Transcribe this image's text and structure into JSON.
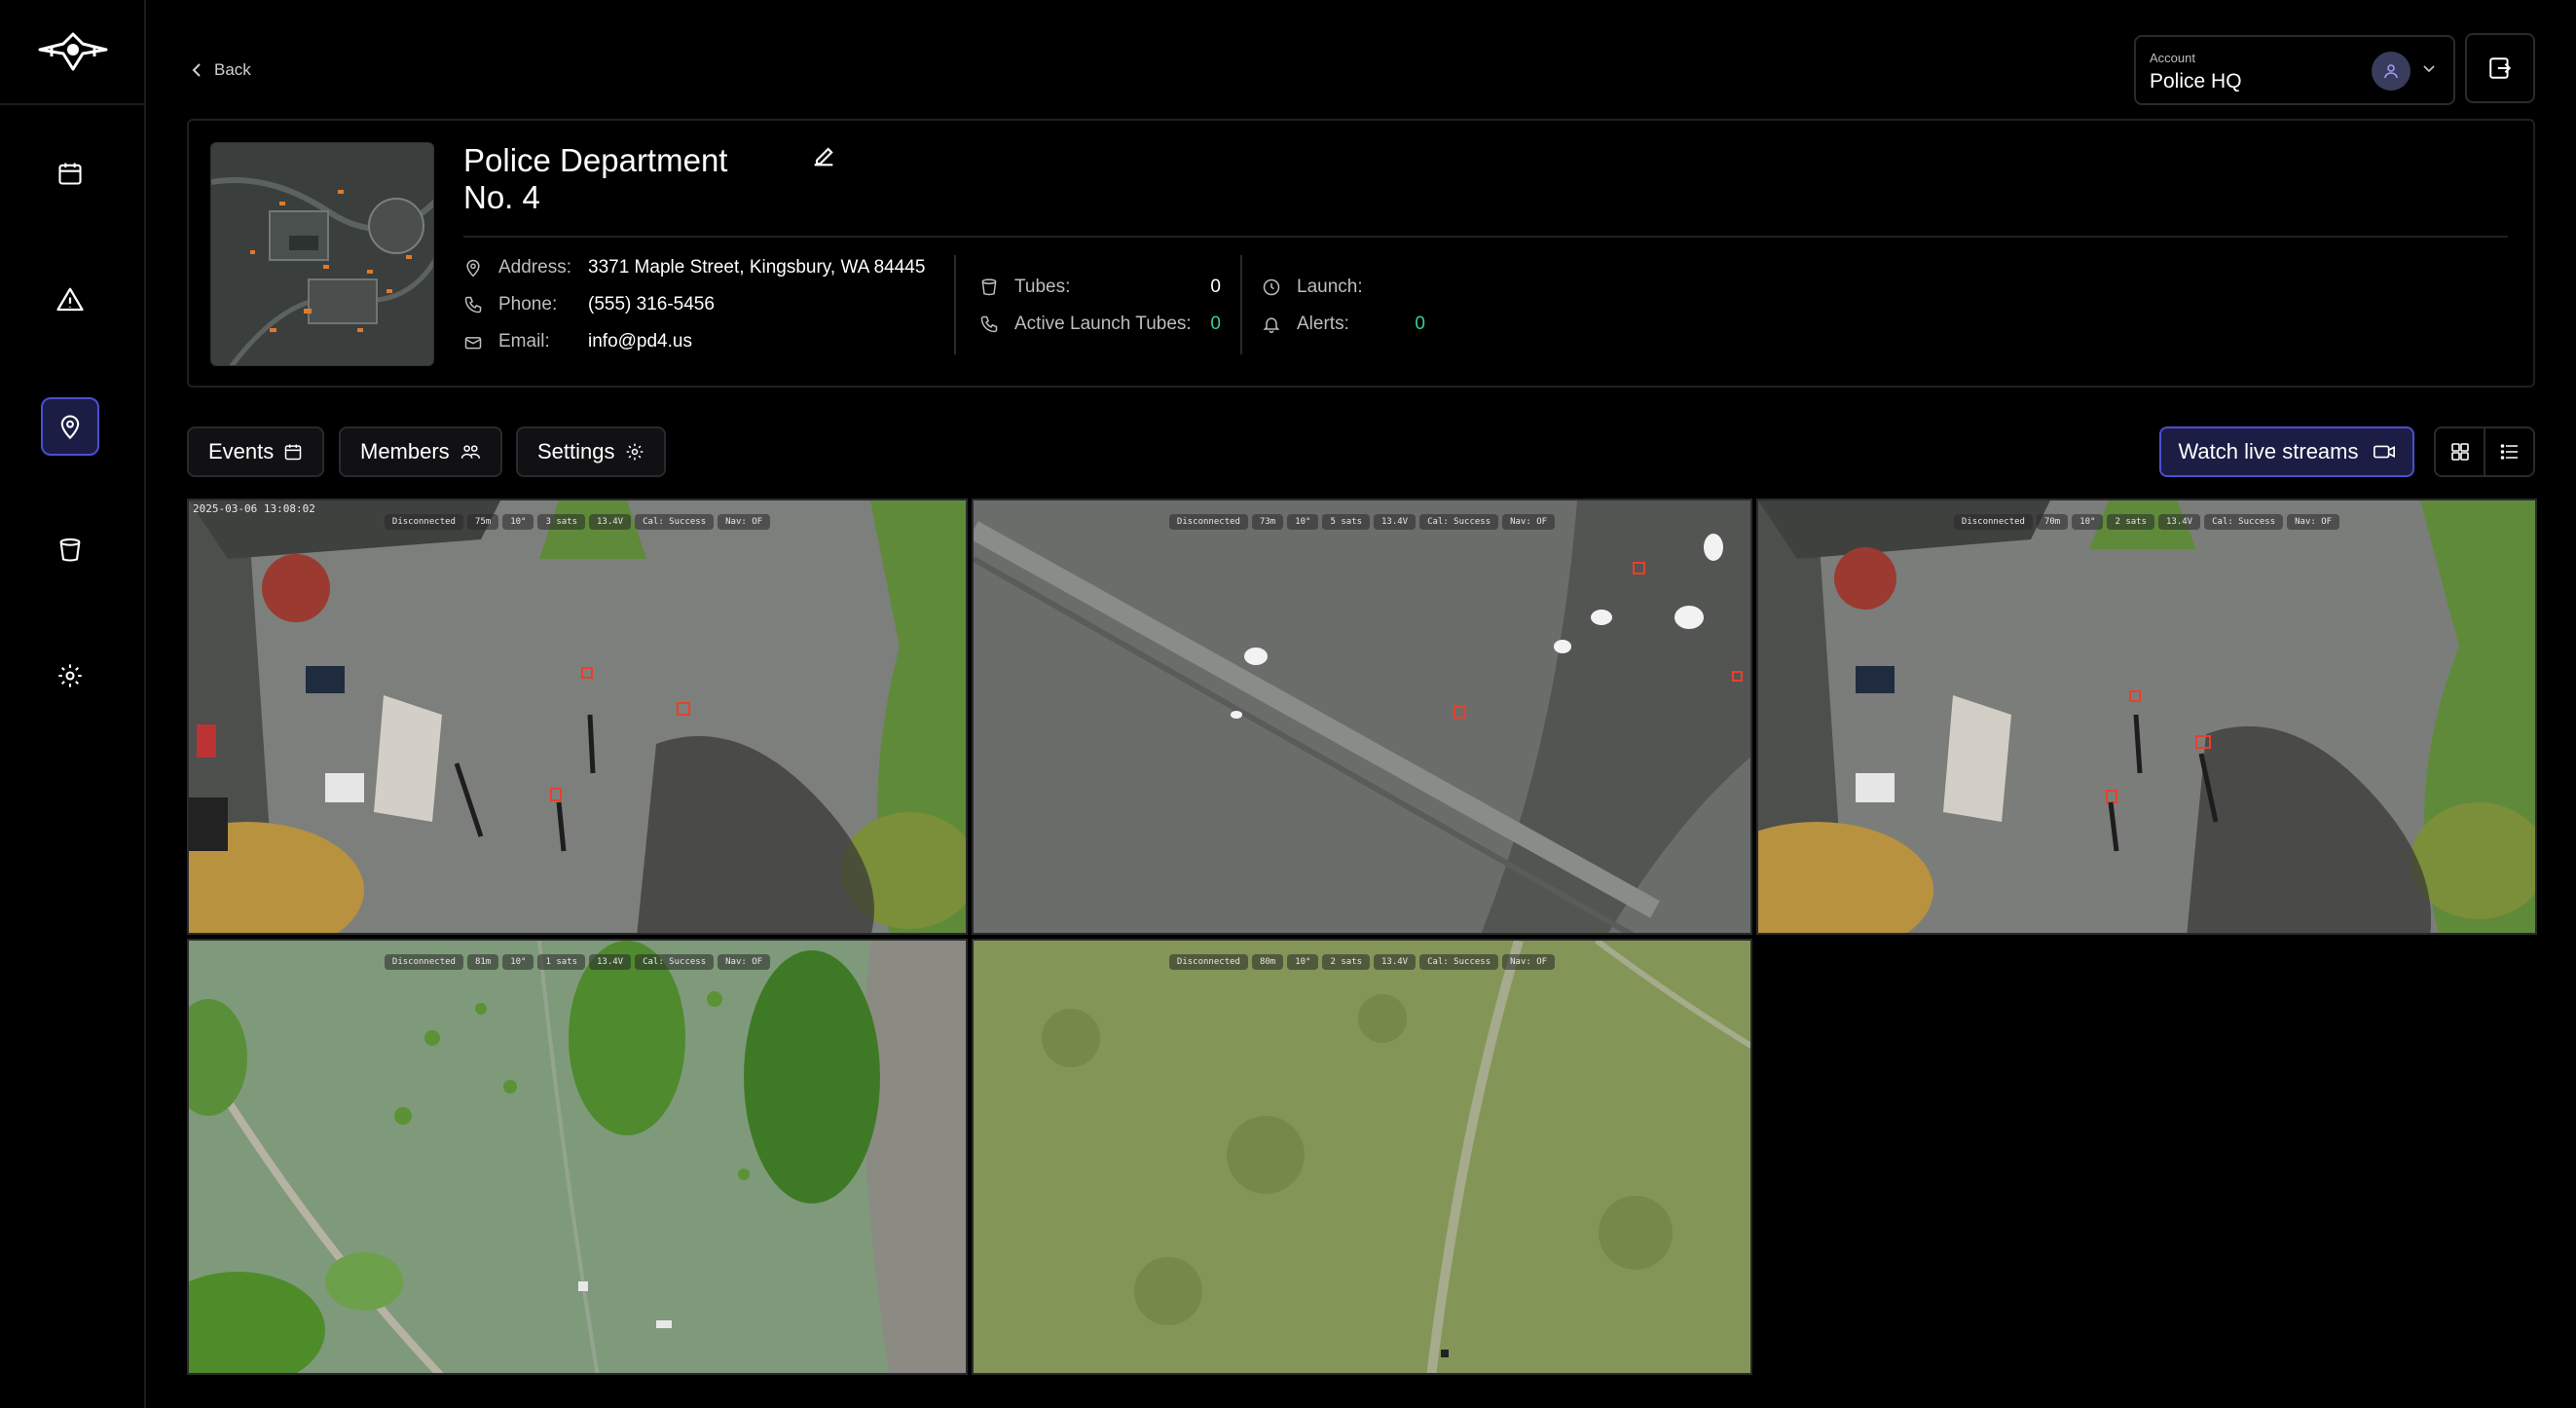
{
  "nav": {
    "back_label": "Back",
    "items": [
      {
        "icon": "calendar-icon",
        "active": false
      },
      {
        "icon": "alert-icon",
        "active": false
      },
      {
        "icon": "location-pin-icon",
        "active": true
      },
      {
        "icon": "tube-icon",
        "active": false
      },
      {
        "icon": "gear-icon",
        "active": false
      }
    ]
  },
  "account": {
    "label": "Account",
    "value": "Police HQ"
  },
  "site": {
    "title": "Police Department No. 4",
    "address_label": "Address:",
    "address": "3371 Maple Street, Kingsbury, WA 84445",
    "phone_label": "Phone:",
    "phone": "(555) 316-5456",
    "email_label": "Email:",
    "email": "info@pd4.us",
    "tubes_label": "Tubes:",
    "tubes": "0",
    "active_tubes_label": "Active Launch Tubes:",
    "active_tubes": "0",
    "launch_label": "Launch:",
    "launch": "",
    "alerts_label": "Alerts:",
    "alerts": "0"
  },
  "toolbar": {
    "events_label": "Events",
    "members_label": "Members",
    "settings_label": "Settings",
    "watch_label": "Watch live streams"
  },
  "feeds": [
    {
      "timestamp": "2025-03-06 13:08:02",
      "hud": [
        "Disconnected",
        "75m",
        "10°",
        "3 sats",
        "13.4V",
        "Cal: Success",
        "Nav: OF"
      ]
    },
    {
      "timestamp": "",
      "hud": [
        "Disconnected",
        "73m",
        "10°",
        "5 sats",
        "13.4V",
        "Cal: Success",
        "Nav: OF"
      ]
    },
    {
      "timestamp": "",
      "hud": [
        "Disconnected",
        "70m",
        "10°",
        "2 sats",
        "13.4V",
        "Cal: Success",
        "Nav: OF"
      ]
    },
    {
      "timestamp": "",
      "hud": [
        "Disconnected",
        "81m",
        "10°",
        "1 sats",
        "13.4V",
        "Cal: Success",
        "Nav: OF"
      ]
    },
    {
      "timestamp": "",
      "hud": [
        "Disconnected",
        "80m",
        "10°",
        "2 sats",
        "13.4V",
        "Cal: Success",
        "Nav: OF"
      ]
    }
  ],
  "colors": {
    "accent": "#4b4fd0",
    "accent_bg": "#1c1d45",
    "success": "#3ccf8e",
    "detection_box": "#e8402a"
  }
}
